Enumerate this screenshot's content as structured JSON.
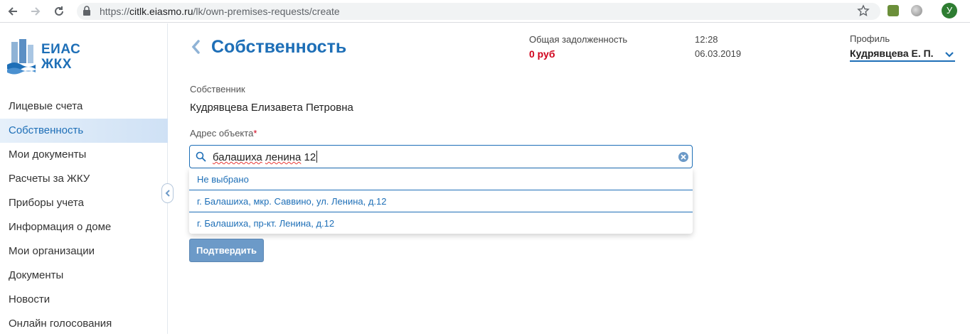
{
  "browser": {
    "url_scheme": "https://",
    "url_host": "citlk.eiasmo.ru",
    "url_path": "/lk/own-premises-requests/create",
    "avatar_letter": "У"
  },
  "sidebar": {
    "logo_line1": "ЕИАС",
    "logo_line2": "ЖКХ",
    "items": [
      {
        "label": "Лицевые счета"
      },
      {
        "label": "Собственность"
      },
      {
        "label": "Мои документы"
      },
      {
        "label": "Расчеты за ЖКУ"
      },
      {
        "label": "Приборы учета"
      },
      {
        "label": "Информация о доме"
      },
      {
        "label": "Мои организации"
      },
      {
        "label": "Документы"
      },
      {
        "label": "Новости"
      },
      {
        "label": "Онлайн голосования"
      }
    ],
    "active_index": 1
  },
  "header": {
    "title": "Собственность",
    "debt_label": "Общая задолженность",
    "debt_value": "0 руб",
    "time": "12:28",
    "date": "06.03.2019",
    "profile_label": "Профиль",
    "profile_name": "Кудрявцева Е. П."
  },
  "form": {
    "owner_label": "Собственник",
    "owner_value": "Кудрявцева Елизавета Петровна",
    "address_label": "Адрес объекта",
    "required_mark": "*",
    "search_word1": "балашиха",
    "search_word2": "ленина",
    "search_word3": "12",
    "options": [
      {
        "label": "Не выбрано"
      },
      {
        "label": "г. Балашиха, мкр. Саввино, ул. Ленина, д.12"
      },
      {
        "label": "г. Балашиха, пр-кт. Ленина, д.12"
      }
    ],
    "confirm_label": "Подтвердить"
  },
  "colors": {
    "accent": "#1e6fb7",
    "debt": "#d0021b",
    "button": "#6c9ac8"
  }
}
